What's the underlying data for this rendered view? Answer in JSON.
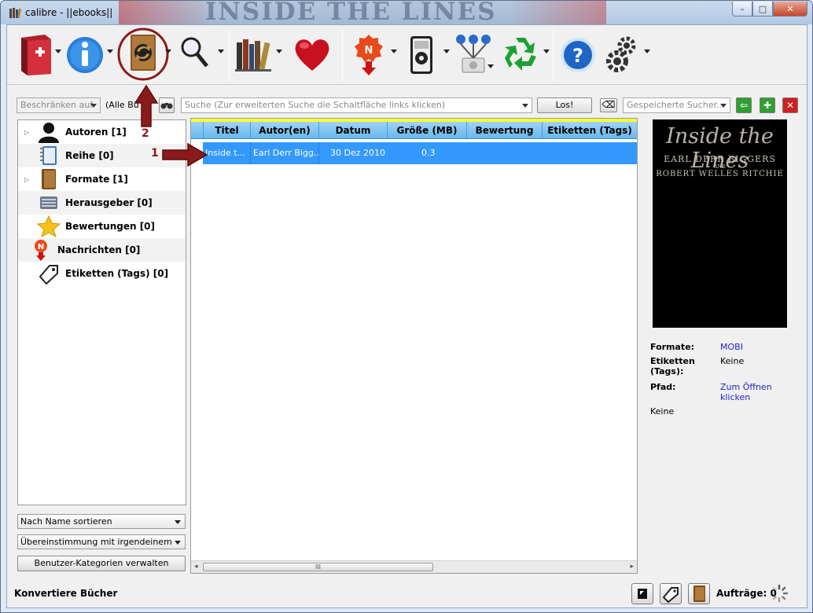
{
  "window": {
    "title": "calibre - ||ebooks||",
    "banner_text": "INSIDE THE LINES",
    "controls": {
      "minimize": "–",
      "maximize": "□",
      "close": "✕"
    }
  },
  "toolbar": {
    "items": [
      {
        "name": "add-books",
        "icon": "red-book-plus-icon"
      },
      {
        "name": "edit-metadata",
        "icon": "info-icon"
      },
      {
        "name": "convert-books",
        "icon": "convert-book-icon"
      },
      {
        "name": "view",
        "icon": "magnifier-icon"
      },
      {
        "name": "library",
        "icon": "books-icon"
      },
      {
        "name": "donate",
        "icon": "heart-icon"
      },
      {
        "name": "fetch-news",
        "icon": "news-icon"
      },
      {
        "name": "send-to-device",
        "icon": "device-icon"
      },
      {
        "name": "connect-share",
        "icon": "network-icon"
      },
      {
        "name": "remove-books",
        "icon": "recycle-icon"
      },
      {
        "name": "help",
        "icon": "help-icon"
      },
      {
        "name": "preferences",
        "icon": "gear-icon"
      }
    ]
  },
  "search": {
    "restrict_placeholder": "Beschränken auf",
    "restrict_label": "(Alle Bü",
    "placeholder": "Suche (Zur erweiterten Suche die Schaltfläche links klicken)",
    "go_label": "Los!",
    "saved_placeholder": "Gespeicherte Sucher...",
    "clear_symbol": "⌫",
    "saved_buttons": {
      "copy": "⇦",
      "save": "✚",
      "delete": "✕"
    }
  },
  "tag_browser": {
    "items": [
      {
        "label": "Autoren [1]",
        "icon": "author-icon",
        "expandable": true
      },
      {
        "label": "Reihe [0]",
        "icon": "series-icon",
        "expandable": false
      },
      {
        "label": "Formate [1]",
        "icon": "book-icon",
        "expandable": true
      },
      {
        "label": "Herausgeber [0]",
        "icon": "typewriter-icon",
        "expandable": false
      },
      {
        "label": "Bewertungen [0]",
        "icon": "star-icon",
        "expandable": false
      },
      {
        "label": "Nachrichten [0]",
        "icon": "news-icon",
        "expandable": false
      },
      {
        "label": "Etiketten (Tags) [0]",
        "icon": "tag-icon",
        "expandable": false
      }
    ],
    "expand_symbol": "▷",
    "sort_label": "Nach Name sortieren",
    "match_label": "Übereinstimmung mit irgendeinem",
    "manage_label": "Benutzer-Kategorien verwalten"
  },
  "book_list": {
    "columns": [
      "Titel",
      "Autor(en)",
      "Datum",
      "Größe (MB)",
      "Bewertung",
      "Etiketten (Tags)"
    ],
    "rows": [
      {
        "title": "Inside t...",
        "author": "Earl Derr Bigg...",
        "date": "30 Dez 2010",
        "size": "0.3",
        "rating": "",
        "tags": ""
      }
    ],
    "scroll_grip": "III",
    "scroll_left": "◂",
    "scroll_right": "▸"
  },
  "book_details": {
    "cover": {
      "title": "Inside the Lines",
      "author1": "EARL DERR BIGGERS",
      "and": "AND",
      "author2": "ROBERT WELLES RITCHIE"
    },
    "formats_label": "Formate:",
    "formats_value": "MOBI",
    "tags_label": "Etiketten (Tags):",
    "tags_value": "Keine",
    "path_label": "Pfad:",
    "path_link": "Zum Öffnen klicken",
    "comments": "Keine"
  },
  "status_bar": {
    "message": "Konvertiere Bücher",
    "jobs_label": "Aufträge: 0"
  },
  "annotations": {
    "arrow1": "1",
    "arrow2": "2"
  },
  "colors": {
    "selection": "#3399ff",
    "header": "#7cc3f2",
    "accent_red": "#8b1a1a"
  }
}
